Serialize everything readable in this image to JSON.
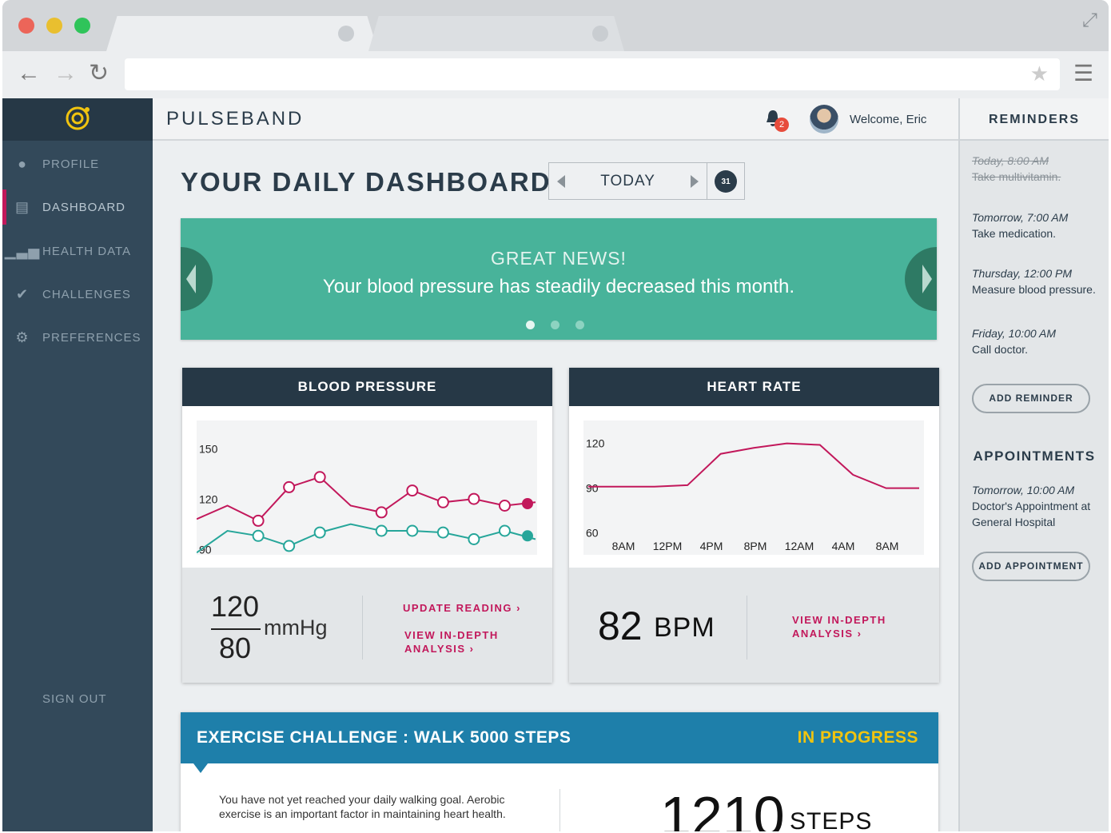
{
  "app": {
    "brand": "PULSEBAND",
    "welcome": "Welcome, Eric",
    "notifications": "2"
  },
  "sidebar": {
    "items": [
      {
        "label": "PROFILE",
        "icon": "user-icon"
      },
      {
        "label": "DASHBOARD",
        "icon": "dashboard-icon"
      },
      {
        "label": "HEALTH DATA",
        "icon": "chart-icon"
      },
      {
        "label": "CHALLENGES",
        "icon": "check-circle-icon"
      },
      {
        "label": "PREFERENCES",
        "icon": "gears-icon"
      }
    ],
    "active": "DASHBOARD",
    "sign_out": "SIGN OUT"
  },
  "dashboard": {
    "title": "YOUR DAILY DASHBOARD",
    "date_label": "TODAY",
    "calendar_day": "31",
    "banner": {
      "title": "GREAT NEWS!",
      "text": "Your blood pressure has steadily decreased this month.",
      "slide": 1,
      "slides": 3
    }
  },
  "blood_pressure": {
    "title": "BLOOD PRESSURE",
    "systolic": "120",
    "diastolic": "80",
    "unit": "mmHg",
    "update_link": "UPDATE READING ›",
    "analysis_link_1": "VIEW IN-DEPTH",
    "analysis_link_2": "ANALYSIS ›"
  },
  "heart_rate": {
    "title": "HEART RATE",
    "value": "82",
    "unit": "BPM",
    "analysis_link_1": "VIEW IN-DEPTH",
    "analysis_link_2": "ANALYSIS ›"
  },
  "challenge": {
    "title": "EXERCISE CHALLENGE : WALK 5000 STEPS",
    "status": "IN PROGRESS",
    "text": "You have not yet reached your daily walking goal. Aerobic exercise is an important factor in maintaining heart health.",
    "steps": "1210",
    "unit": "STEPS"
  },
  "reminders": {
    "title": "REMINDERS",
    "items": [
      {
        "when": "Today, 8:00 AM",
        "what": "Take multivitamin.",
        "done": true
      },
      {
        "when": "Tomorrow, 7:00 AM",
        "what": "Take medication.",
        "done": false
      },
      {
        "when": "Thursday, 12:00 PM",
        "what": "Measure blood pressure.",
        "done": false
      },
      {
        "when": "Friday, 10:00 AM",
        "what": "Call doctor.",
        "done": false
      }
    ],
    "add_button": "ADD REMINDER"
  },
  "appointments": {
    "title": "APPOINTMENTS",
    "items": [
      {
        "when": "Tomorrow, 10:00 AM",
        "what_1": "Doctor's Appointment at",
        "what_2": "General Hospital"
      }
    ],
    "add_button": "ADD APPOINTMENT"
  },
  "colors": {
    "accent": "#c2185b",
    "teal": "#48b39a",
    "navy": "#263846",
    "blue": "#1e7faa",
    "yellow": "#f1c40f"
  },
  "chart_data": [
    {
      "type": "line",
      "title": "BLOOD PRESSURE",
      "yticks": [
        90,
        120,
        150
      ],
      "ylim": [
        85,
        165
      ],
      "x": [
        1,
        2,
        3,
        4,
        5,
        6,
        7,
        8,
        9,
        10,
        11,
        12
      ],
      "series": [
        {
          "values": [
            112,
            120,
            111,
            131,
            137,
            120,
            116,
            129,
            122,
            124,
            120,
            122
          ],
          "color": "#c2185b",
          "markers": [
            2,
            3,
            4,
            6,
            7,
            8,
            9,
            10
          ]
        },
        {
          "values": [
            92,
            105,
            102,
            96,
            104,
            109,
            105,
            105,
            104,
            100,
            105,
            100
          ],
          "color": "#26a69a",
          "markers": [
            2,
            3,
            4,
            6,
            7,
            8,
            9,
            10
          ]
        }
      ]
    },
    {
      "type": "line",
      "title": "HEART RATE",
      "categories": [
        "8AM",
        "12PM",
        "4PM",
        "8PM",
        "12AM",
        "4AM",
        "8AM"
      ],
      "yticks": [
        60,
        90,
        120
      ],
      "ylim": [
        55,
        130
      ],
      "series": [
        {
          "values": [
            91,
            91,
            91,
            92,
            113,
            117,
            120,
            119,
            99,
            90,
            90
          ],
          "color": "#c2185b"
        }
      ]
    }
  ]
}
